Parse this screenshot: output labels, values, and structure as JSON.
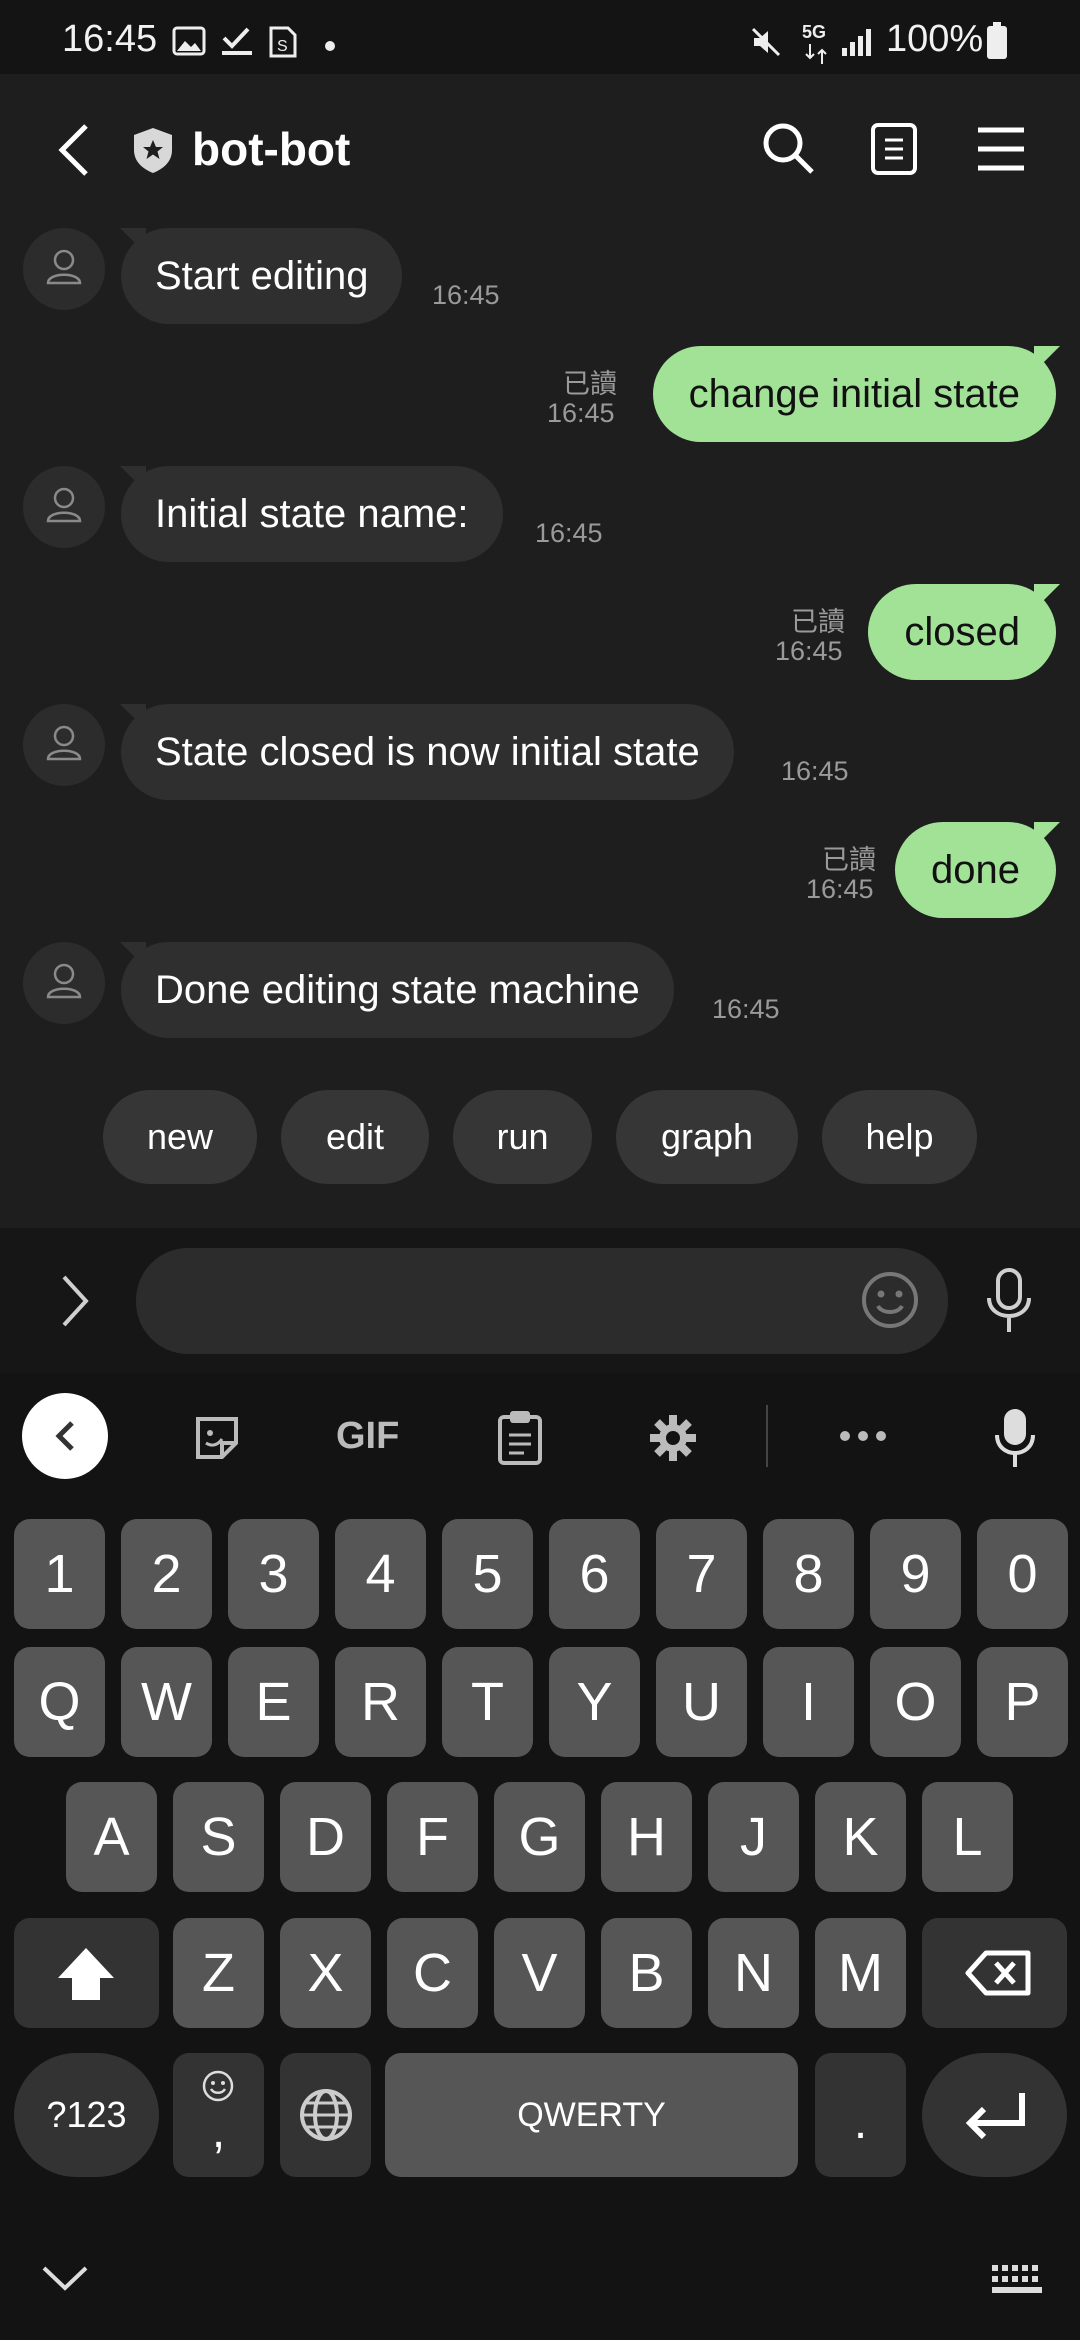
{
  "status_bar": {
    "time": "16:45",
    "battery": "100%",
    "network": "5G",
    "icons": [
      "image-icon",
      "check-icon",
      "sim-icon",
      "dot-icon",
      "mute-icon",
      "signal-icon",
      "battery-icon"
    ]
  },
  "header": {
    "title": "bot-bot",
    "icons": [
      "back-icon",
      "shield-icon",
      "search-icon",
      "notes-icon",
      "menu-icon"
    ]
  },
  "messages": [
    {
      "side": "in",
      "text": "Start editing",
      "time": "16:45"
    },
    {
      "side": "out",
      "text": "change initial state",
      "time": "16:45",
      "read": "已讀"
    },
    {
      "side": "in",
      "text": "Initial state name:",
      "time": "16:45"
    },
    {
      "side": "out",
      "text": "closed",
      "time": "16:45",
      "read": "已讀"
    },
    {
      "side": "in",
      "text": "State closed is now initial state",
      "time": "16:45"
    },
    {
      "side": "out",
      "text": "done",
      "time": "16:45",
      "read": "已讀"
    },
    {
      "side": "in",
      "text": "Done editing state machine",
      "time": "16:45"
    }
  ],
  "quick_replies": [
    "new",
    "edit",
    "run",
    "graph",
    "help"
  ],
  "input": {
    "placeholder": ""
  },
  "keyboard": {
    "toolbar": {
      "gif": "GIF"
    },
    "row_numbers": [
      "1",
      "2",
      "3",
      "4",
      "5",
      "6",
      "7",
      "8",
      "9",
      "0"
    ],
    "row1": [
      "Q",
      "W",
      "E",
      "R",
      "T",
      "Y",
      "U",
      "I",
      "O",
      "P"
    ],
    "row2": [
      "A",
      "S",
      "D",
      "F",
      "G",
      "H",
      "J",
      "K",
      "L"
    ],
    "row3": [
      "Z",
      "X",
      "C",
      "V",
      "B",
      "N",
      "M"
    ],
    "symbols": "?123",
    "comma": ",",
    "space": "QWERTY",
    "period": "."
  }
}
